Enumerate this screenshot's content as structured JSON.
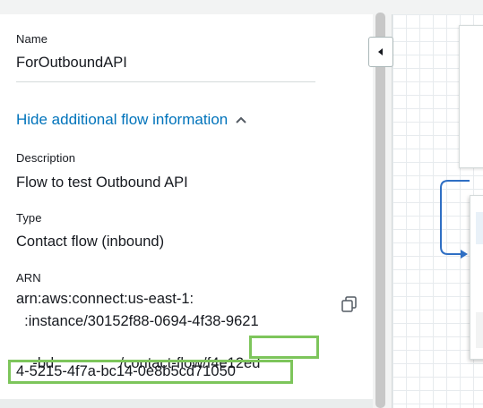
{
  "panel": {
    "name_label": "Name",
    "name_value": "ForOutboundAPI",
    "toggle_label": "Hide additional flow information",
    "description_label": "Description",
    "description_value": "Flow to test Outbound API",
    "type_label": "Type",
    "type_value": "Contact flow (inbound)",
    "arn_label": "ARN",
    "arn_line1": "arn:aws:connect:us-east-1:",
    "arn_line2": "  :instance/30152f88-0694-4f38-9621",
    "arn_line3_prefix": "-bd                /contact-flow/",
    "arn_line3_highlight": "f4e12ed",
    "arn_line4_highlight": "4-5215-4f7a-bc14-0e8b5cd71050"
  },
  "icons": {
    "toggle": "chevron-up-icon",
    "copy": "copy-icon",
    "collapse": "caret-left-icon",
    "connector_arrow": "arrow-right-icon"
  },
  "colors": {
    "link": "#0073bb",
    "highlight": "#7dc55b",
    "connector": "#2f6fc4"
  }
}
